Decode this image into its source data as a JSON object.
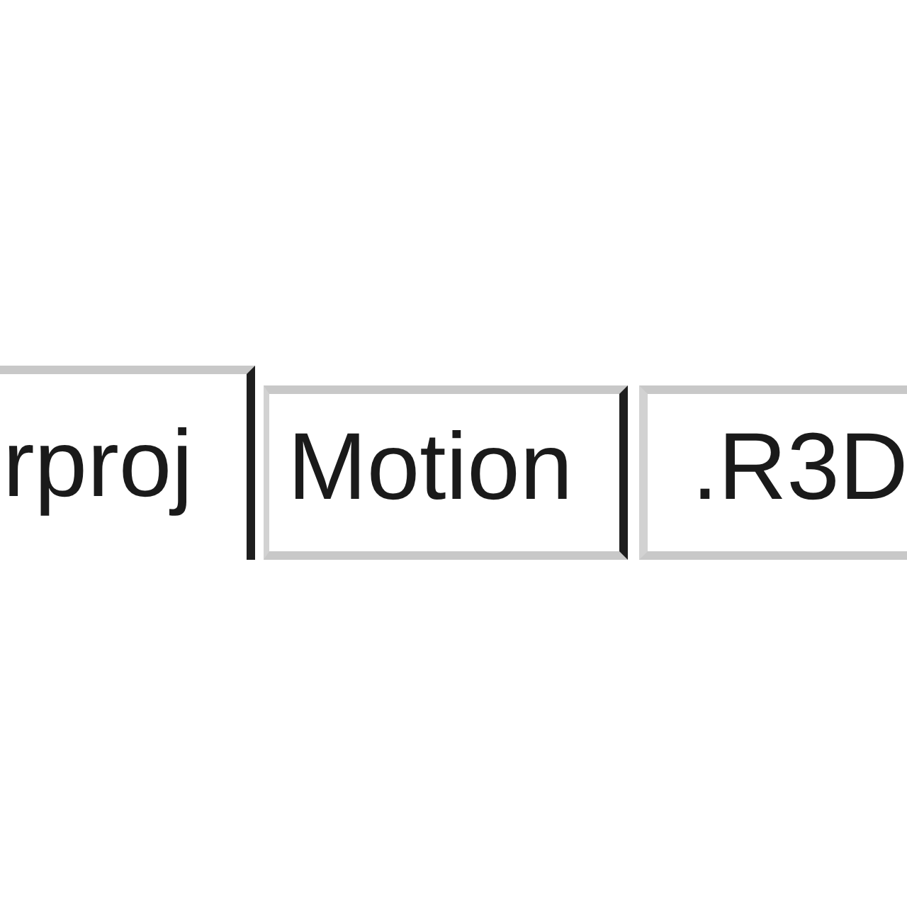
{
  "tabs": [
    {
      "label": "rproj",
      "selected": true
    },
    {
      "label": "Motion",
      "selected": false
    },
    {
      "label": ".R3D",
      "selected": false
    }
  ]
}
